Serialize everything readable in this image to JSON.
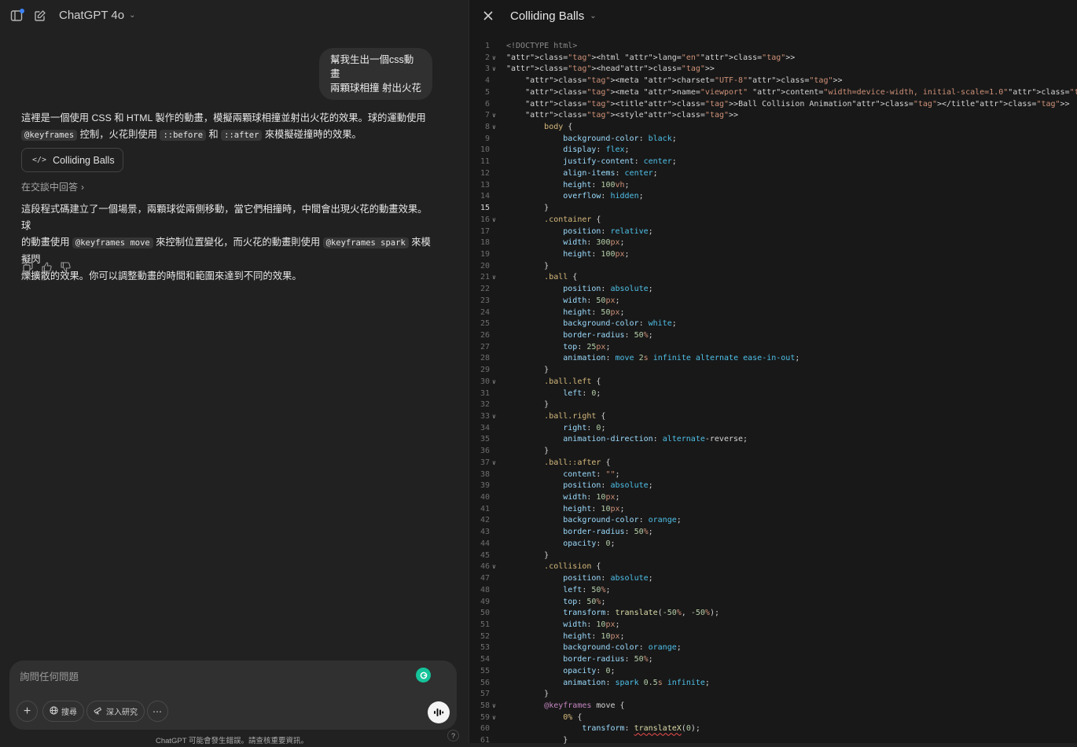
{
  "header": {
    "model_label": "ChatGPT 4o",
    "sidebar_icon": "sidebar-toggle-icon",
    "new_chat_icon": "new-chat-icon"
  },
  "conversation": {
    "user_message": [
      "幫我生出一個css動畫",
      "兩顆球相撞 射出火花"
    ],
    "intro": {
      "line1": "這裡是一個使用 CSS 和 HTML 製作的動畫，模擬兩顆球相撞並射出火花的效果。球的運動使用",
      "code1": "@keyframes",
      "t1": " 控制，火花則使用 ",
      "code2": "::before",
      "t2": " 和 ",
      "code3": "::after",
      "t3": " 來模擬碰撞時的效果。"
    },
    "canvas_button_label": "Colliding Balls",
    "answer_in_chat": "在交談中回答",
    "outro": {
      "line1": "這段程式碼建立了一個場景，兩顆球從兩側移動，當它們相撞時，中間會出現火花的動畫效果。球",
      "t1": "的動畫使用 ",
      "code1": "@keyframes move",
      "t2": " 來控制位置變化，而火花的動畫則使用 ",
      "code2": "@keyframes spark",
      "t3": " 來模擬閃",
      "line3": "爍擴散的效果。你可以調整動畫的時間和範圍來達到不同的效果。"
    }
  },
  "composer": {
    "placeholder": "詢問任何問題",
    "search_label": "搜尋",
    "deep_research_label": "深入研究",
    "disclaimer": "ChatGPT 可能會發生錯誤。請查核重要資訊。",
    "help": "?"
  },
  "canvas": {
    "title": "Colliding Balls",
    "active_line": 15
  },
  "code_lines": [
    "<!DOCTYPE html>",
    "<html lang=\"en\">",
    "<head>",
    "    <meta charset=\"UTF-8\">",
    "    <meta name=\"viewport\" content=\"width=device-width, initial-scale=1.0\">",
    "    <title>Ball Collision Animation</title>",
    "    <style>",
    "        body {",
    "            background-color: black;",
    "            display: flex;",
    "            justify-content: center;",
    "            align-items: center;",
    "            height: 100vh;",
    "            overflow: hidden;",
    "        }",
    "        .container {",
    "            position: relative;",
    "            width: 300px;",
    "            height: 100px;",
    "        }",
    "        .ball {",
    "            position: absolute;",
    "            width: 50px;",
    "            height: 50px;",
    "            background-color: white;",
    "            border-radius: 50%;",
    "            top: 25px;",
    "            animation: move 2s infinite alternate ease-in-out;",
    "        }",
    "        .ball.left {",
    "            left: 0;",
    "        }",
    "        .ball.right {",
    "            right: 0;",
    "            animation-direction: alternate-reverse;",
    "        }",
    "        .ball::after {",
    "            content: \"\";",
    "            position: absolute;",
    "            width: 10px;",
    "            height: 10px;",
    "            background-color: orange;",
    "            border-radius: 50%;",
    "            opacity: 0;",
    "        }",
    "        .collision {",
    "            position: absolute;",
    "            left: 50%;",
    "            top: 50%;",
    "            transform: translate(-50%, -50%);",
    "            width: 10px;",
    "            height: 10px;",
    "            background-color: orange;",
    "            border-radius: 50%;",
    "            opacity: 0;",
    "            animation: spark 0.5s infinite;",
    "        }",
    "        @keyframes move {",
    "            0% {",
    "                transform: translateX(0);",
    "            }"
  ],
  "fold_lines": [
    2,
    3,
    7,
    8,
    16,
    21,
    30,
    33,
    37,
    46,
    58,
    59
  ]
}
